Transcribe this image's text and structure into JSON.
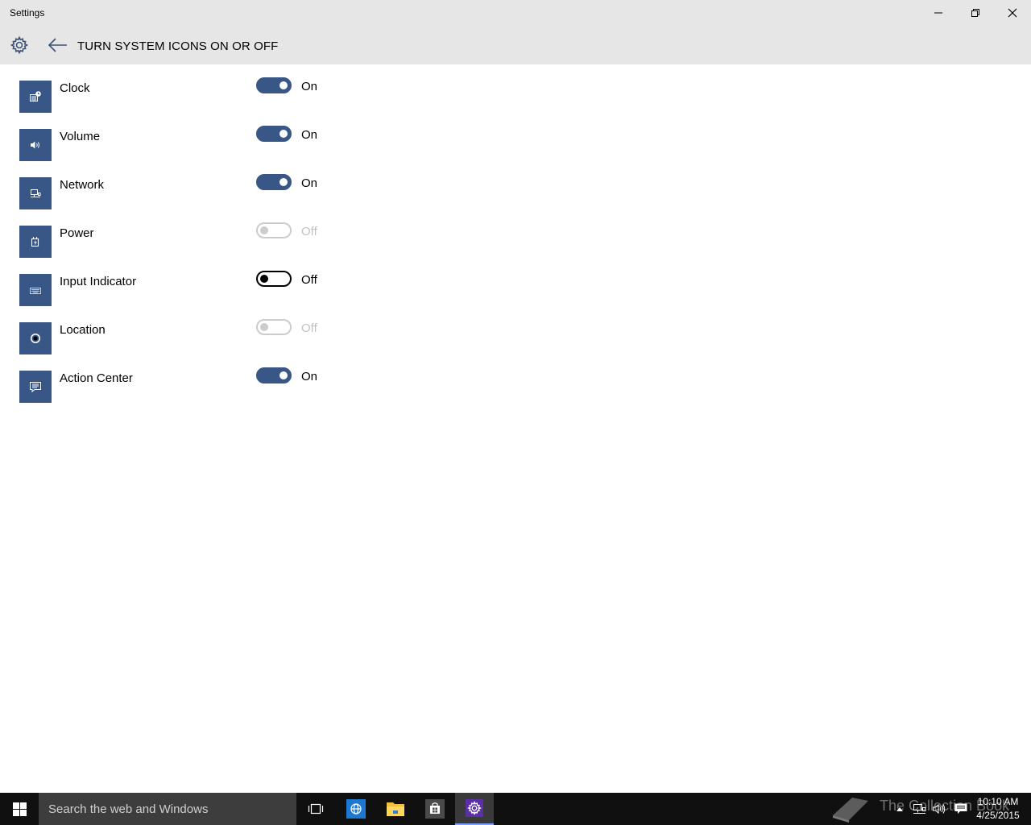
{
  "window": {
    "title": "Settings",
    "minimize_icon": "minimize-icon",
    "maximize_icon": "restore-icon",
    "close_icon": "close-icon"
  },
  "header": {
    "title": "TURN SYSTEM ICONS ON OR OFF",
    "settings_icon": "gear-icon",
    "back_icon": "arrow-left-icon"
  },
  "items": [
    {
      "label": "Clock",
      "state": "On",
      "toggle": "on",
      "icon": "clock-icon"
    },
    {
      "label": "Volume",
      "state": "On",
      "toggle": "on",
      "icon": "volume-icon"
    },
    {
      "label": "Network",
      "state": "On",
      "toggle": "on",
      "icon": "network-icon"
    },
    {
      "label": "Power",
      "state": "Off",
      "toggle": "disabled",
      "icon": "power-icon"
    },
    {
      "label": "Input Indicator",
      "state": "Off",
      "toggle": "off",
      "icon": "keyboard-icon"
    },
    {
      "label": "Location",
      "state": "Off",
      "toggle": "disabled",
      "icon": "location-icon"
    },
    {
      "label": "Action Center",
      "state": "On",
      "toggle": "on",
      "icon": "action-center-icon"
    }
  ],
  "taskbar": {
    "search_placeholder": "Search the web and Windows",
    "apps": [
      "task-view-icon",
      "internet-explorer-icon",
      "file-explorer-icon",
      "store-icon",
      "settings-icon"
    ],
    "watermark_text": "The Collection Book",
    "time": "10:10 AM",
    "date": "4/25/2015"
  },
  "colors": {
    "accent": "#385686",
    "chrome": "#e6e6e6",
    "taskbar": "#101010",
    "search": "#3d3d3d",
    "disabled": "#cccccc"
  }
}
